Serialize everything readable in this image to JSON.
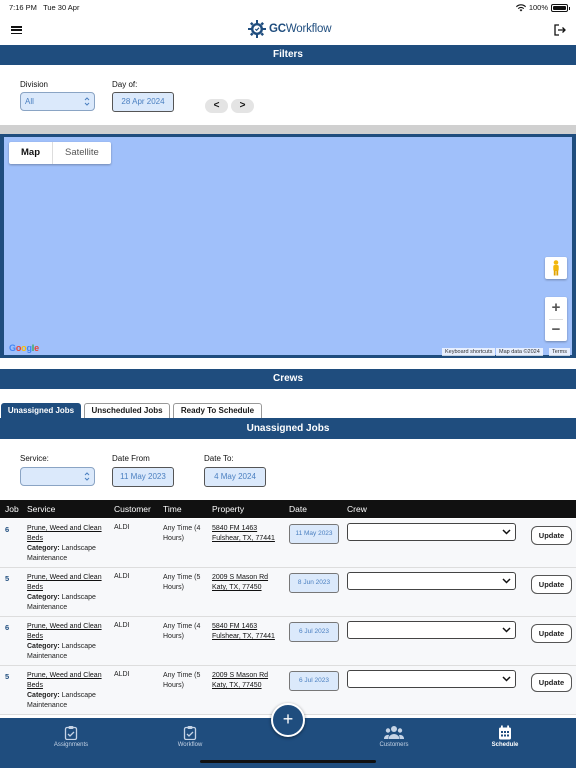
{
  "status_bar": {
    "time": "7:16 PM",
    "date": "Tue 30 Apr",
    "battery": "100%"
  },
  "header": {
    "logo_bold": "GC",
    "logo_text": "Workflow"
  },
  "filters": {
    "title": "Filters",
    "division_label": "Division",
    "division_value": "All",
    "day_of_label": "Day of:",
    "day_of_value": "28 Apr 2024",
    "prev_label": "<",
    "next_label": ">"
  },
  "map": {
    "map_tab": "Map",
    "satellite_tab": "Satellite",
    "zoom_in": "+",
    "zoom_out": "−",
    "keyboard_shortcuts": "Keyboard shortcuts",
    "map_data": "Map data ©2024",
    "terms": "Terms",
    "background_color": "#a0c0fa"
  },
  "crews": {
    "title": "Crews",
    "tabs": [
      "Unassigned Jobs",
      "Unscheduled Jobs",
      "Ready To Schedule"
    ],
    "panel_title": "Unassigned Jobs",
    "service_label": "Service:",
    "service_value": "",
    "date_from_label": "Date From",
    "date_from_value": "11 May 2023",
    "date_to_label": "Date To:",
    "date_to_value": "4 May 2024"
  },
  "table": {
    "headers": [
      "Job",
      "Service",
      "Customer",
      "Time",
      "Property",
      "Date",
      "Crew"
    ],
    "category_label": "Category:",
    "update_label": "Update",
    "rows": [
      {
        "job": "6",
        "service": "Prune, Weed and Clean Beds",
        "category": "Landscape Maintenance",
        "customer": "ALDI",
        "time": "Any Time (4 Hours)",
        "property_line1": "5840 FM 1463",
        "property_line2": "Fulshear, TX, 77441",
        "date": "11 May 2023",
        "crew": ""
      },
      {
        "job": "5",
        "service": "Prune, Weed and Clean Beds",
        "category": "Landscape Maintenance",
        "customer": "ALDI",
        "time": "Any Time (5 Hours)",
        "property_line1": "2009 S Mason Rd",
        "property_line2": "Katy, TX, 77450",
        "date": "8 Jun 2023",
        "crew": ""
      },
      {
        "job": "6",
        "service": "Prune, Weed and Clean Beds",
        "category": "Landscape Maintenance",
        "customer": "ALDI",
        "time": "Any Time (4 Hours)",
        "property_line1": "5840 FM 1463",
        "property_line2": "Fulshear, TX, 77441",
        "date": "6 Jul 2023",
        "crew": ""
      },
      {
        "job": "5",
        "service": "Prune, Weed and Clean Beds",
        "category": "Landscape Maintenance",
        "customer": "ALDI",
        "time": "Any Time (5 Hours)",
        "property_line1": "2009 S Mason Rd",
        "property_line2": "Katy, TX, 77450",
        "date": "6 Jul 2023",
        "crew": ""
      }
    ]
  },
  "bottom_nav": {
    "items": [
      "Assignments",
      "Workflow",
      "Customers",
      "Schedule"
    ],
    "active": "Schedule",
    "fab_label": "+"
  },
  "colors": {
    "primary": "#1f4d7e",
    "date_bg": "#dbe9fb",
    "date_text": "#4a7fc0"
  }
}
